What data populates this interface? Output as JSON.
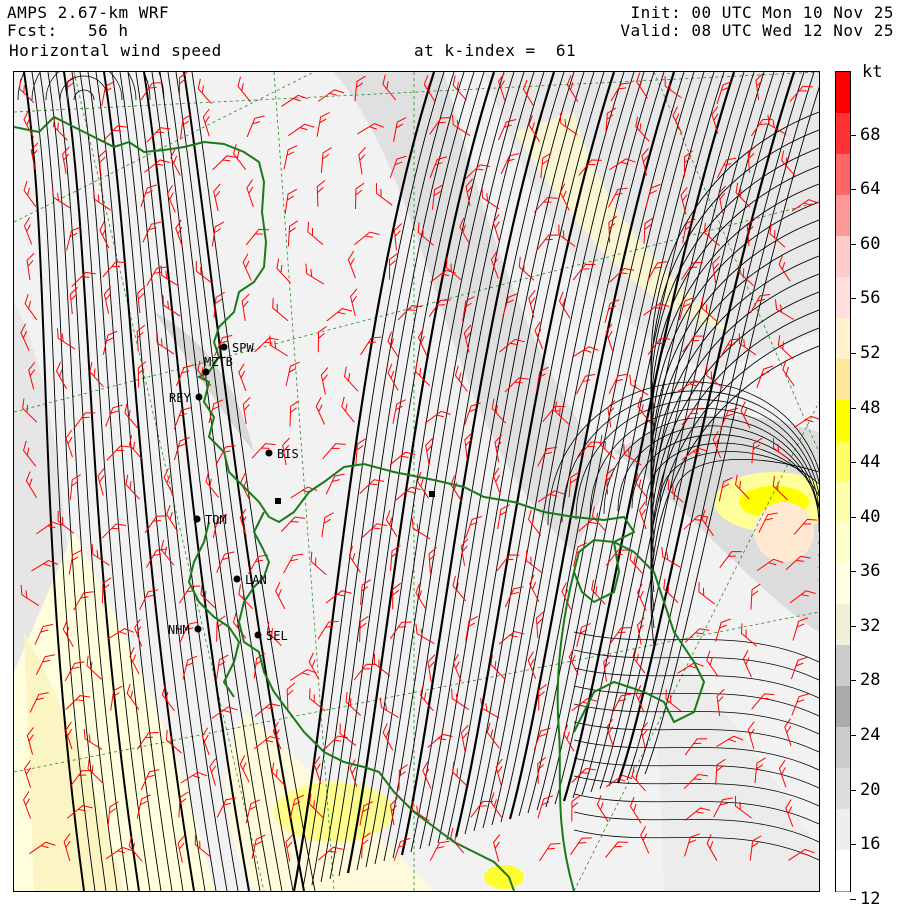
{
  "header": {
    "model": "AMPS 2.67-km WRF",
    "fcst_label": "Fcst:",
    "fcst_value": "56 h",
    "field": "Horizontal wind speed",
    "level": "at k-index =  61",
    "init": "Init: 00 UTC Mon 10 Nov 25",
    "valid": "Valid: 08 UTC Wed 12 Nov 25"
  },
  "colorbar": {
    "unit": "kt",
    "labels": [
      "68",
      "64",
      "60",
      "56",
      "52",
      "48",
      "44",
      "40",
      "36",
      "32",
      "28",
      "24",
      "20",
      "16",
      "12"
    ],
    "colors": [
      "#ff0000",
      "#ff3333",
      "#ff6666",
      "#ff9999",
      "#ffcccc",
      "#ffdede",
      "#fff2cc",
      "#ffe699",
      "#ffff00",
      "#ffff66",
      "#ffffaa",
      "#ffffcc",
      "#ffffe4",
      "#f0f0d8",
      "#cccccc",
      "#aaaaaa",
      "#cccccc",
      "#dddddd",
      "#eeeeee",
      "#ffffff"
    ]
  },
  "stations": [
    {
      "id": "stn-spw",
      "label": "SPW"
    },
    {
      "id": "stn-mztb",
      "label": "MZTB"
    },
    {
      "id": "stn-rey",
      "label": "REY"
    },
    {
      "id": "stn-bis",
      "label": "BIS"
    },
    {
      "id": "stn-tom",
      "label": "TOM"
    },
    {
      "id": "stn-lan",
      "label": "LAN"
    },
    {
      "id": "stn-nhm",
      "label": "NHM"
    },
    {
      "id": "stn-sel",
      "label": "SEL"
    }
  ],
  "map_colors": {
    "coastline": "#1a7a1a",
    "streamline": "#000000",
    "barb": "#ff0000",
    "grid": "#2a8a2a"
  }
}
